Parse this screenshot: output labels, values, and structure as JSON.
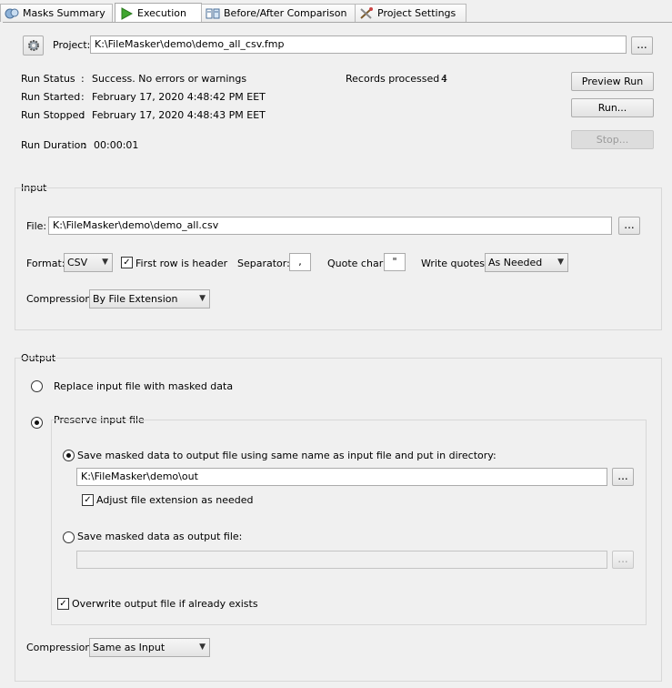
{
  "tabs": [
    {
      "label": "Masks Summary",
      "icon": "masks-summary-icon"
    },
    {
      "label": "Execution",
      "icon": "play-icon"
    },
    {
      "label": "Before/After Comparison",
      "icon": "comparison-icon"
    },
    {
      "label": "Project Settings",
      "icon": "tools-icon"
    }
  ],
  "project": {
    "label": "Project:",
    "path": "K:\\FileMasker\\demo\\demo_all_csv.fmp",
    "browse": "..."
  },
  "run": {
    "status_label": "Run Status",
    "status_value": "Success. No errors or warnings",
    "started_label": "Run Started",
    "started_value": "February 17, 2020 4:48:42 PM EET",
    "stopped_label": "Run Stopped",
    "stopped_value": "February 17, 2020 4:48:43 PM EET",
    "duration_label": "Run Duration",
    "duration_value": "00:00:01",
    "records_label": "Records processed :",
    "records_value": "4",
    "colon": ":"
  },
  "buttons": {
    "preview": "Preview Run",
    "run": "Run...",
    "stop": "Stop..."
  },
  "input": {
    "title": "Input",
    "file_label": "File:",
    "file_path": "K:\\FileMasker\\demo\\demo_all.csv",
    "browse": "...",
    "format_label": "Format:",
    "format_value": "CSV",
    "header_label": "First row is header",
    "separator_label": "Separator:",
    "separator_value": ",",
    "quote_label": "Quote char:",
    "quote_value": "\"",
    "write_quotes_label": "Write quotes:",
    "write_quotes_value": "As Needed",
    "compression_label": "Compression:",
    "compression_value": "By File Extension"
  },
  "output": {
    "title": "Output",
    "replace_label": "Replace input file with masked data",
    "preserve_label": "Preserve input file",
    "same_name_label": "Save masked data to output file using same name as input file and put in directory:",
    "dir_path": "K:\\FileMasker\\demo\\out",
    "browse": "...",
    "adjust_label": "Adjust file extension as needed",
    "save_as_label": "Save masked data as output file:",
    "save_as_path": "",
    "overwrite_label": "Overwrite output file if already exists",
    "compression_label": "Compression:",
    "compression_value": "Same as Input"
  }
}
